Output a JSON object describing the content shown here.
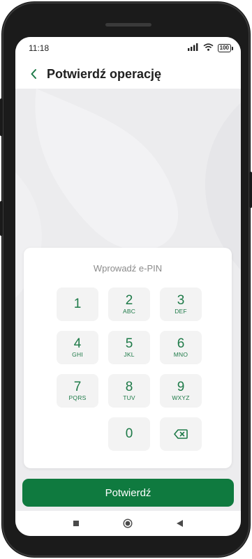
{
  "status_bar": {
    "time": "11:18",
    "battery": "100"
  },
  "header": {
    "title": "Potwierdź operację"
  },
  "pin_pad": {
    "label": "Wprowadź e-PIN",
    "keys": [
      {
        "digit": "1",
        "letters": ""
      },
      {
        "digit": "2",
        "letters": "ABC"
      },
      {
        "digit": "3",
        "letters": "DEF"
      },
      {
        "digit": "4",
        "letters": "GHI"
      },
      {
        "digit": "5",
        "letters": "JKL"
      },
      {
        "digit": "6",
        "letters": "MNO"
      },
      {
        "digit": "7",
        "letters": "PQRS"
      },
      {
        "digit": "8",
        "letters": "TUV"
      },
      {
        "digit": "9",
        "letters": "WXYZ"
      },
      {
        "digit": "0",
        "letters": ""
      }
    ],
    "backspace_icon": "backspace-icon"
  },
  "confirm_button": {
    "label": "Potwierdź"
  },
  "colors": {
    "accent": "#0f7a3f",
    "key_text": "#1e7a48",
    "key_bg": "#f3f3f3",
    "screen_bg": "#ececee"
  }
}
